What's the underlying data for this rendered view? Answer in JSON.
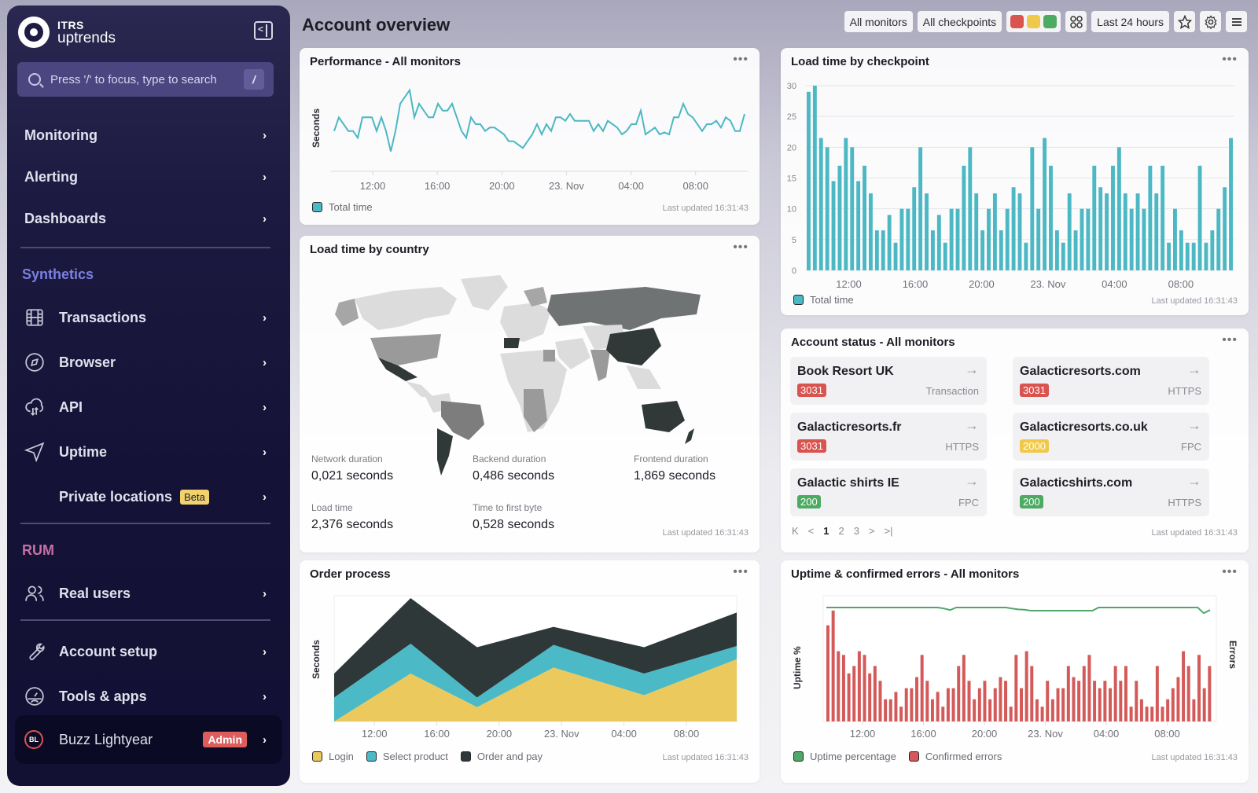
{
  "brand": {
    "top": "ITRS",
    "bottom": "uptrends"
  },
  "search": {
    "placeholder": "Press '/' to focus, type to search",
    "shortcut": "/"
  },
  "sidebar": {
    "main": [
      {
        "label": "Monitoring"
      },
      {
        "label": "Alerting"
      },
      {
        "label": "Dashboards"
      }
    ],
    "synthetics_label": "Synthetics",
    "synthetics": [
      {
        "label": "Transactions",
        "icon": "film-icon"
      },
      {
        "label": "Browser",
        "icon": "compass-icon"
      },
      {
        "label": "API",
        "icon": "cloud-sync-icon"
      },
      {
        "label": "Uptime",
        "icon": "send-icon"
      },
      {
        "label": "Private locations",
        "badge": "Beta"
      }
    ],
    "rum_label": "RUM",
    "rum": [
      {
        "label": "Real users",
        "icon": "users-icon"
      }
    ],
    "bottom": [
      {
        "label": "Account setup",
        "icon": "wrench-icon"
      },
      {
        "label": "Tools & apps",
        "icon": "gauge-icon"
      }
    ],
    "user": {
      "initials": "BL",
      "name": "Buzz Lightyear",
      "role": "Admin"
    },
    "colors": {
      "synthetics": "#7b7fe0",
      "rum": "#c76fa6"
    }
  },
  "header": {
    "title": "Account overview",
    "filters": {
      "monitors": "All monitors",
      "checkpoints": "All checkpoints",
      "period": "Last 24 hours"
    },
    "status_colors": [
      "#d9534f",
      "#f0c94a",
      "#4caa62"
    ]
  },
  "x_ticks": [
    "12:00",
    "16:00",
    "20:00",
    "23. Nov",
    "04:00",
    "08:00"
  ],
  "last_updated": "Last updated 16:31:43",
  "performance": {
    "title": "Performance - All monitors",
    "ylabel": "Seconds",
    "legend": "Total time",
    "color": "#4bb8c4",
    "values": [
      5,
      7,
      6,
      5,
      5,
      4,
      7,
      7,
      7,
      5,
      7,
      5,
      2,
      5,
      9,
      10,
      11,
      7,
      9,
      8,
      7,
      7,
      9,
      8,
      8,
      9,
      7,
      5,
      4,
      7,
      6,
      6,
      5,
      5.5,
      5.5,
      5,
      4.5,
      3.5,
      3.5,
      3,
      2.5,
      3.5,
      4.5,
      6,
      4.5,
      6,
      5,
      7,
      7,
      6.5,
      7.5,
      6.5,
      6.5,
      6.5,
      6.5,
      5,
      6,
      5,
      6.5,
      6,
      5.5,
      4.5,
      5,
      6,
      6,
      8,
      4.5,
      5,
      5.5,
      4.5,
      4.8,
      4.5,
      7,
      7,
      9,
      7.5,
      7,
      6,
      5,
      6,
      6,
      6.5,
      5.5,
      7,
      6.5,
      5,
      5,
      7.5
    ]
  },
  "checkpoint": {
    "title": "Load time by checkpoint",
    "legend": "Total time",
    "color": "#4bb8c4",
    "y_ticks": [
      0,
      5,
      10,
      15,
      20,
      25,
      30
    ],
    "ylim": [
      0,
      30
    ],
    "values": [
      29,
      30,
      21.5,
      20,
      14.5,
      17,
      21.5,
      20,
      14.5,
      17,
      12.5,
      6.5,
      6.5,
      9,
      4.5,
      10,
      10,
      13.5,
      20,
      12.5,
      6.5,
      9,
      4.5,
      10,
      10,
      17,
      20,
      12.5,
      6.5,
      10,
      12.5,
      6.5,
      10,
      13.5,
      12.5,
      4.5,
      20,
      10,
      21.5,
      17,
      6.5,
      4.5,
      12.5,
      6.5,
      10,
      10,
      17,
      13.5,
      12.5,
      17,
      20,
      12.5,
      10,
      12.5,
      10,
      17,
      12.5,
      17,
      4.5,
      10,
      6.5,
      4.5,
      4.5,
      17,
      4.5,
      6.5,
      10,
      13.5,
      21.5
    ]
  },
  "country": {
    "title": "Load time by country",
    "metrics": [
      {
        "label": "Network duration",
        "value": "0,021 seconds"
      },
      {
        "label": "Backend duration",
        "value": "0,486 seconds"
      },
      {
        "label": "Frontend duration",
        "value": "1,869 seconds"
      },
      {
        "label": "Load time",
        "value": "2,376 seconds"
      },
      {
        "label": "Time to first byte",
        "value": "0,528 seconds"
      }
    ]
  },
  "account_status": {
    "title": "Account status - All monitors",
    "monitors": [
      {
        "name": "Book Resort UK",
        "code": "3031",
        "type": "Transaction",
        "color": "#d9534f"
      },
      {
        "name": "Galacticresorts.com",
        "code": "3031",
        "type": "HTTPS",
        "color": "#d9534f"
      },
      {
        "name": "Galacticresorts.fr",
        "code": "3031",
        "type": "HTTPS",
        "color": "#d9534f"
      },
      {
        "name": "Galacticresorts.co.uk",
        "code": "2000",
        "type": "FPC",
        "color": "#f0c94a"
      },
      {
        "name": "Galactic shirts IE",
        "code": "200",
        "type": "FPC",
        "color": "#4caa62"
      },
      {
        "name": "Galacticshirts.com",
        "code": "200",
        "type": "HTTPS",
        "color": "#4caa62"
      }
    ],
    "pager": {
      "first": "K",
      "prev": "<",
      "pages": [
        "1",
        "2",
        "3"
      ],
      "current": "1",
      "next": ">",
      "last": ">|"
    }
  },
  "order": {
    "title": "Order process",
    "ylabel": "Seconds",
    "series": [
      {
        "name": "Login",
        "color": "#ebc95c",
        "values": [
          0,
          4,
          1.2,
          4.5,
          2.2,
          5.2
        ]
      },
      {
        "name": "Select product",
        "color": "#4bbac6",
        "values": [
          2,
          2.5,
          0.8,
          1.9,
          1.8,
          1.1
        ]
      },
      {
        "name": "Order and pay",
        "color": "#2e3839",
        "values": [
          2,
          3.8,
          4.2,
          1.5,
          2.2,
          2.8
        ]
      }
    ],
    "ymax": 10.5
  },
  "uptime": {
    "title": "Uptime & confirmed errors - All monitors",
    "ylabel_left": "Uptime %",
    "ylabel_right": "Errors",
    "legend": [
      "Uptime percentage",
      "Confirmed errors"
    ],
    "colors": {
      "uptime": "#4fa86a",
      "errors": "#d45a5a"
    },
    "uptime_values": [
      100,
      100,
      100,
      100,
      100,
      100,
      100,
      100,
      100,
      100,
      100,
      100,
      100,
      100,
      100,
      100,
      100,
      100,
      100,
      99.7,
      99.2,
      100,
      100,
      100,
      100,
      100,
      100,
      100,
      100,
      100,
      99.7,
      99.4,
      99.3,
      99,
      99,
      99,
      99,
      99,
      99,
      99,
      99,
      99,
      99,
      99,
      100,
      100,
      100,
      100,
      100,
      100,
      100,
      100,
      100,
      100,
      100,
      100,
      100,
      100,
      100,
      100,
      100,
      98.2,
      99.2
    ],
    "errors": [
      26,
      30,
      19,
      18,
      13,
      15,
      19,
      18,
      13,
      15,
      11,
      6,
      6,
      8,
      4,
      9,
      9,
      12,
      18,
      11,
      6,
      8,
      4,
      9,
      9,
      15,
      18,
      11,
      6,
      9,
      11,
      6,
      9,
      12,
      11,
      4,
      18,
      9,
      19,
      15,
      6,
      4,
      11,
      6,
      9,
      9,
      15,
      12,
      11,
      15,
      18,
      11,
      9,
      11,
      9,
      15,
      11,
      15,
      4,
      11,
      6,
      4,
      4,
      15,
      4,
      6,
      9,
      12,
      19,
      15,
      6,
      18,
      9,
      15
    ]
  }
}
